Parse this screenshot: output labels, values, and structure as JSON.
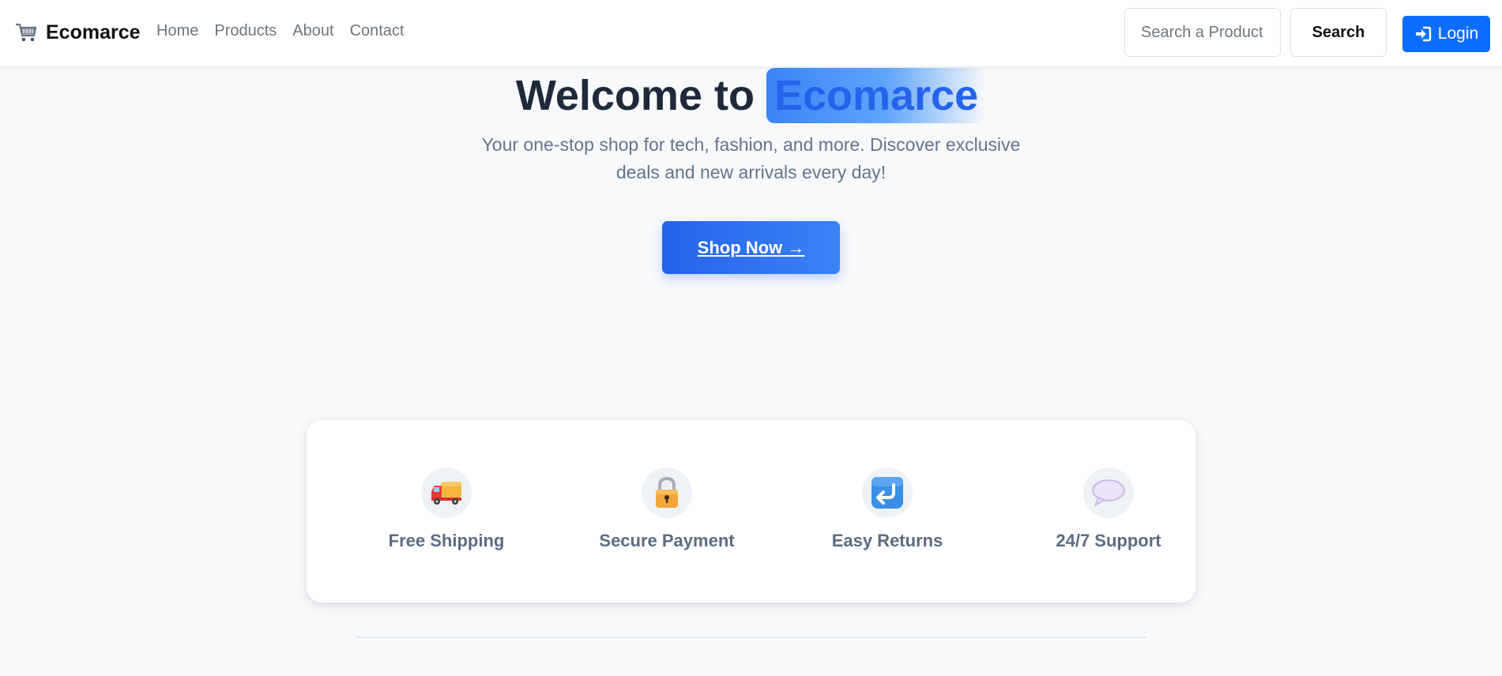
{
  "navbar": {
    "brand": "Ecomarce",
    "links": [
      "Home",
      "Products",
      "About",
      "Contact"
    ],
    "search_placeholder": "Search a Product ...",
    "search_button": "Search",
    "login_button": "Login"
  },
  "hero": {
    "title_prefix": "Welcome to ",
    "title_highlight": "Ecomarce",
    "subtitle": "Your one-stop shop for tech, fashion, and more. Discover exclusive deals and new arrivals every day!",
    "cta_label": "Shop Now  →"
  },
  "features": [
    {
      "icon": "truck-icon",
      "label": "Free Shipping"
    },
    {
      "icon": "lock-icon",
      "label": "Secure Payment"
    },
    {
      "icon": "return-arrow-icon",
      "label": "Easy Returns"
    },
    {
      "icon": "speech-bubble-icon",
      "label": "24/7 Support"
    }
  ],
  "colors": {
    "primary": "#0d6efd",
    "heading": "#1e293b",
    "muted": "#64748b",
    "background": "#f7f9fb"
  }
}
